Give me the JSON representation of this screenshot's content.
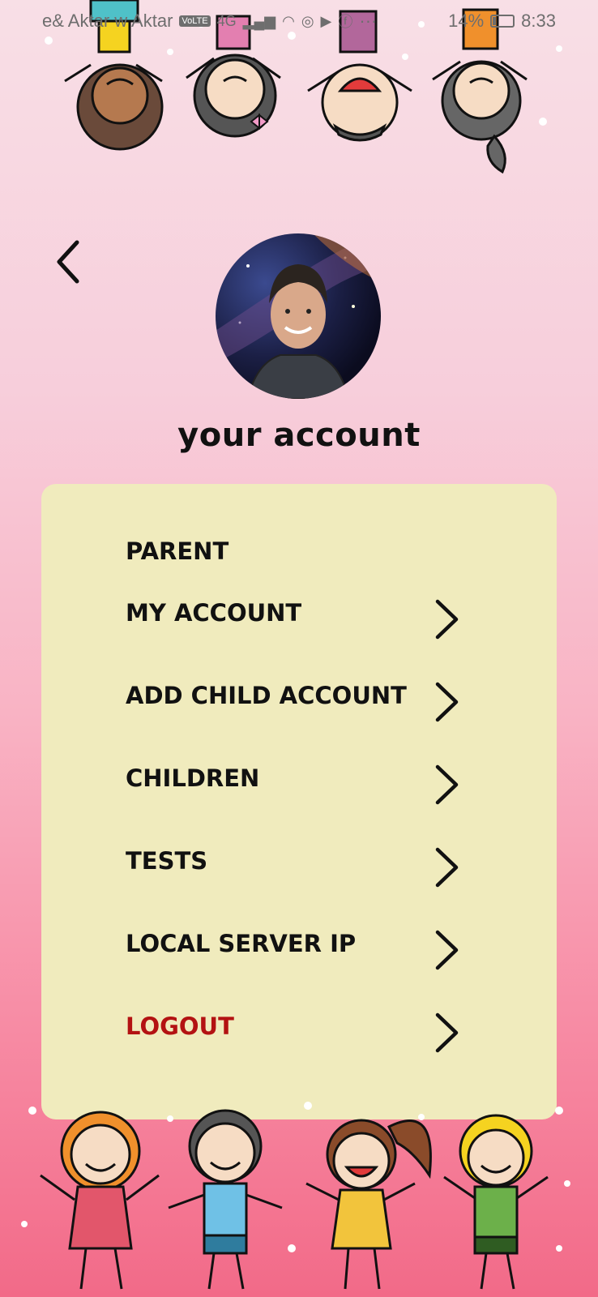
{
  "status_bar": {
    "carrier": "e& Aktar w Aktar",
    "volte": "VoLTE",
    "network": "4G",
    "more": "···",
    "battery": "14%",
    "time": "8:33"
  },
  "header": {
    "title": "your account",
    "back_icon": "chevron-left-icon",
    "avatar": "profile-photo"
  },
  "menu": {
    "section_label": "PARENT",
    "items": [
      {
        "label": "MY ACCOUNT",
        "icon": "chevron-right-icon"
      },
      {
        "label": "ADD CHILD ACCOUNT",
        "icon": "chevron-right-icon"
      },
      {
        "label": "CHILDREN",
        "icon": "chevron-right-icon"
      },
      {
        "label": "TESTS",
        "icon": "chevron-right-icon"
      },
      {
        "label": "LOCAL SERVER IP",
        "icon": "chevron-right-icon"
      },
      {
        "label": "LOGOUT",
        "icon": "chevron-right-icon"
      }
    ]
  },
  "colors": {
    "card": "#f0ebbd",
    "logout": "#b31212",
    "text": "#111111"
  }
}
